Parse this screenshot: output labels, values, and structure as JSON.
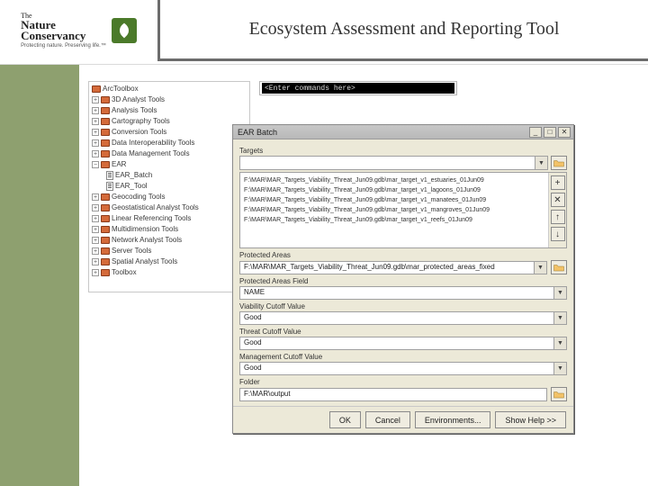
{
  "header": {
    "logo": {
      "line1": "The",
      "line2": "Nature",
      "line3": "Conservancy",
      "tagline": "Protecting nature. Preserving life.™"
    },
    "title": "Ecosystem Assessment and Reporting Tool"
  },
  "toolbox": {
    "root": "ArcToolbox",
    "items": [
      "3D Analyst Tools",
      "Analysis Tools",
      "Cartography Tools",
      "Conversion Tools",
      "Data Interoperability Tools",
      "Data Management Tools",
      "EAR"
    ],
    "ear_children": [
      "EAR_Batch",
      "EAR_Tool"
    ],
    "items_after": [
      "Geocoding Tools",
      "Geostatistical Analyst Tools",
      "Linear Referencing Tools",
      "Multidimension Tools",
      "Network Analyst Tools",
      "Server Tools",
      "Spatial Analyst Tools",
      "Toolbox"
    ]
  },
  "cmdline": {
    "placeholder": "<Enter commands here>"
  },
  "dialog": {
    "title": "EAR Batch",
    "sections": {
      "targets_label": "Targets",
      "targets": [
        "F:\\MAR\\MAR_Targets_Viability_Threat_Jun09.gdb\\mar_target_v1_estuaries_01Jun09",
        "F:\\MAR\\MAR_Targets_Viability_Threat_Jun09.gdb\\mar_target_v1_lagoons_01Jun09",
        "F:\\MAR\\MAR_Targets_Viability_Threat_Jun09.gdb\\mar_target_v1_manatees_01Jun09",
        "F:\\MAR\\MAR_Targets_Viability_Threat_Jun09.gdb\\mar_target_v1_mangroves_01Jun09",
        "F:\\MAR\\MAR_Targets_Viability_Threat_Jun09.gdb\\mar_target_v1_reefs_01Jun09"
      ],
      "protected_areas_label": "Protected Areas",
      "protected_areas_value": "F:\\MAR\\MAR_Targets_Viability_Threat_Jun09.gdb\\mar_protected_areas_fixed",
      "protected_field_label": "Protected Areas Field",
      "protected_field_value": "NAME",
      "viability_label": "Viability Cutoff Value",
      "viability_value": "Good",
      "threat_label": "Threat Cutoff Value",
      "threat_value": "Good",
      "management_label": "Management Cutoff Value",
      "management_value": "Good",
      "folder_label": "Folder",
      "folder_value": "F:\\MAR\\output"
    },
    "buttons": {
      "ok": "OK",
      "cancel": "Cancel",
      "env": "Environments...",
      "help": "Show Help >>"
    },
    "icons": {
      "add": "+",
      "remove": "✕",
      "up": "↑",
      "down": "↓"
    }
  }
}
